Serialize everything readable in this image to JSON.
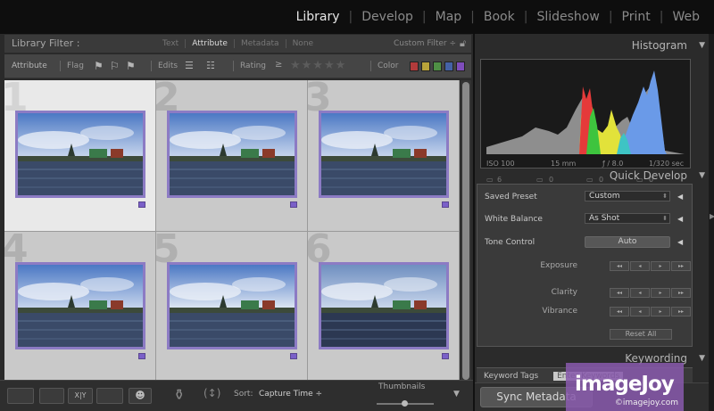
{
  "modules": [
    {
      "label": "Library",
      "active": true
    },
    {
      "label": "Develop",
      "active": false
    },
    {
      "label": "Map",
      "active": false
    },
    {
      "label": "Book",
      "active": false
    },
    {
      "label": "Slideshow",
      "active": false
    },
    {
      "label": "Print",
      "active": false
    },
    {
      "label": "Web",
      "active": false
    }
  ],
  "filter_bar": {
    "title": "Library Filter :",
    "options": [
      "Text",
      "Attribute",
      "Metadata",
      "None"
    ],
    "active_option": "Attribute",
    "preset": "Custom Filter ÷",
    "lock_icon": "lock-icon"
  },
  "attribute_bar": {
    "attribute_label": "Attribute",
    "flag_label": "Flag",
    "edits_label": "Edits",
    "rating_label": "Rating",
    "rating_operator": "≥",
    "stars": "★★★★★",
    "color_label": "Color",
    "color_swatches": [
      "#b23b3b",
      "#b9a33a",
      "#4f8f45",
      "#4562a6",
      "#7f4dbb"
    ]
  },
  "grid": {
    "cells": [
      {
        "number": "1",
        "selected": true
      },
      {
        "number": "2",
        "selected": false
      },
      {
        "number": "3",
        "selected": false
      },
      {
        "number": "4",
        "selected": false
      },
      {
        "number": "5",
        "selected": false
      },
      {
        "number": "6",
        "selected": false
      }
    ]
  },
  "toolbar": {
    "sort_label": "Sort:",
    "sort_value": "Capture Time ÷",
    "thumbnails_label": "Thumbnails",
    "view_icons": [
      "grid-view-icon",
      "loupe-view-icon",
      "compare-view-icon",
      "survey-view-icon",
      "people-view-icon"
    ]
  },
  "histogram": {
    "title": "Histogram",
    "iso": "ISO 100",
    "focal": "15 mm",
    "aperture": "ƒ / 8.0",
    "shutter": "1/320 sec",
    "original_count": "6",
    "zeros": [
      "0",
      "0",
      "0"
    ]
  },
  "quick_develop": {
    "title": "Quick Develop",
    "saved_preset_label": "Saved Preset",
    "saved_preset_value": "Custom",
    "white_balance_label": "White Balance",
    "white_balance_value": "As Shot",
    "tone_control_label": "Tone Control",
    "auto_label": "Auto",
    "exposure_label": "Exposure",
    "clarity_label": "Clarity",
    "vibrance_label": "Vibrance",
    "stepper_glyphs": [
      "◂◂",
      "◂",
      "▸",
      "▸▸"
    ],
    "reset_label": "Reset All"
  },
  "keywording": {
    "title": "Keywording",
    "tags_label": "Keyword Tags",
    "tags_entry": "Enter Keywords"
  },
  "sync": {
    "button_label": "Sync Metadata"
  },
  "watermark": {
    "brand": "imageJoy",
    "sub": "©imagejoy.com"
  },
  "colors": {
    "accent_purple": "#8c7bc4",
    "module_active": "#e6e6e6",
    "panel_bg": "#2b2b2b"
  }
}
